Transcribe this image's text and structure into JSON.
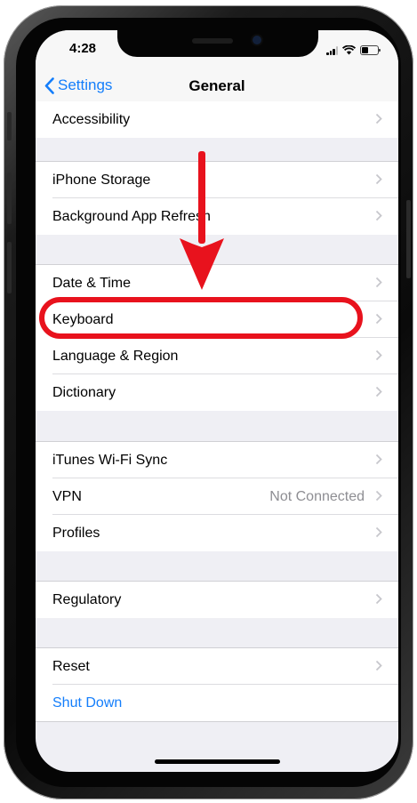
{
  "statusbar": {
    "time": "4:28"
  },
  "navbar": {
    "back_label": "Settings",
    "title": "General"
  },
  "rows": [
    {
      "label": "Accessibility",
      "value": ""
    },
    {
      "label": "iPhone Storage",
      "value": ""
    },
    {
      "label": "Background App Refresh",
      "value": ""
    },
    {
      "label": "Date & Time",
      "value": ""
    },
    {
      "label": "Keyboard",
      "value": ""
    },
    {
      "label": "Language & Region",
      "value": ""
    },
    {
      "label": "Dictionary",
      "value": ""
    },
    {
      "label": "iTunes Wi-Fi Sync",
      "value": ""
    },
    {
      "label": "VPN",
      "value": "Not Connected"
    },
    {
      "label": "Profiles",
      "value": ""
    },
    {
      "label": "Regulatory",
      "value": ""
    },
    {
      "label": "Reset",
      "value": ""
    },
    {
      "label": "Shut Down",
      "value": ""
    }
  ],
  "annotation": {
    "color": "#e8121d",
    "target": "Keyboard"
  },
  "colors": {
    "accent": "#147efb",
    "background": "#efeff4",
    "chevron": "#c7c7cc"
  }
}
